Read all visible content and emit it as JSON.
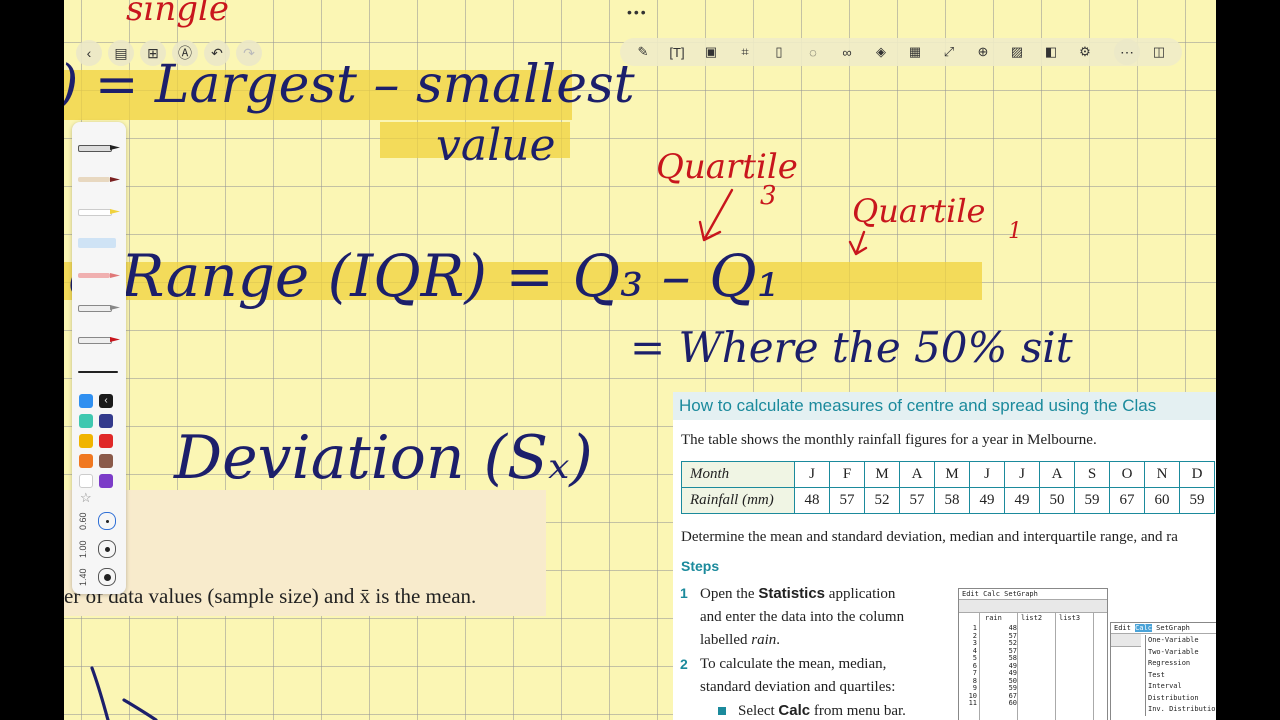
{
  "toolbar": {
    "left_icons": [
      "back-icon",
      "sidebar-icon",
      "grid-icon",
      "marker-icon",
      "undo-icon",
      "redo-icon"
    ],
    "right_icons": [
      "pen-tool-icon",
      "text-box-icon",
      "image-icon",
      "crop-icon",
      "ruler-icon",
      "comment-icon",
      "link-icon",
      "layers-icon",
      "ocr-icon",
      "expand-icon",
      "add-page-icon",
      "background-icon",
      "split-view-icon",
      "settings-icon",
      "more-icon",
      "panel-icon"
    ]
  },
  "colors": {
    "paper": "#fbf6b4",
    "highlight": "#f0d23c",
    "ink_blue": "#1c1f6b",
    "ink_red": "#c8161d",
    "accent_teal": "#1b8a9c",
    "swatches": [
      "#2f8ff0",
      "#1a1a1a",
      "#3fc8b0",
      "#333a8c",
      "#f0b400",
      "#e02828",
      "#f07820",
      "#8a5a4a",
      "#ffffff",
      "#7c3cc8"
    ]
  },
  "palette": {
    "sizes": [
      "0.60",
      "1.00",
      "1.40"
    ]
  },
  "handwriting": {
    "range_def": ") = Largest – smallest",
    "range_def_2": "value",
    "single_top": "single",
    "iqr": "é  Range  (IQR) = Q₃ – Q₁",
    "where": "= Where the 50% sit",
    "std_dev": "Deviation (Sₓ)",
    "quartile3": "Quartile",
    "quartile3_num": "3",
    "quartile1": "Quartile",
    "quartile1_num": "1"
  },
  "notes": {
    "formula_text": "er of data values (sample size) and x̄ is the mean."
  },
  "book": {
    "title": "How to calculate measures of centre and spread using the Clas",
    "intro": "The table shows the monthly rainfall figures for a year in Melbourne.",
    "table": {
      "row1_label": "Month",
      "months": [
        "J",
        "F",
        "M",
        "A",
        "M",
        "J",
        "J",
        "A",
        "S",
        "O",
        "N",
        "D"
      ],
      "row2_label": "Rainfall (mm)",
      "rainfall": [
        "48",
        "57",
        "52",
        "57",
        "58",
        "49",
        "49",
        "50",
        "59",
        "67",
        "60",
        "59"
      ]
    },
    "determine": "Determine the mean and standard deviation, median and interquartile range, and ra",
    "steps_heading": "Steps",
    "step1_num": "1",
    "step1_a": "Open the ",
    "step1_b": "Statistics",
    "step1_c": " application",
    "step1_d": "and enter the data into the column",
    "step1_e": "labelled ",
    "step1_f": "rain",
    "step1_g": ".",
    "step2_num": "2",
    "step2_a": "To calculate the mean, median,",
    "step2_b": "standard deviation and quartiles:",
    "bullet1_a": "Select ",
    "bullet1_b": "Calc",
    "bullet1_c": " from menu bar.",
    "calc1": {
      "menu": "Edit  Calc  SetGraph",
      "headers": [
        "rain",
        "list2",
        "list3"
      ],
      "rows": [
        "1",
        "2",
        "3",
        "4",
        "5",
        "6",
        "7",
        "8",
        "9",
        "10",
        "11"
      ],
      "values": [
        "48",
        "57",
        "52",
        "57",
        "58",
        "49",
        "49",
        "50",
        "59",
        "67",
        "60"
      ]
    },
    "calc2": {
      "menu_edit": "Edit",
      "menu_calc": "Calc",
      "menu_setgraph": "SetGraph",
      "items": [
        "One-Variable",
        "Two-Variable",
        "Regression",
        "Test",
        "Interval",
        "Distribution",
        "Inv. Distribution"
      ]
    }
  }
}
